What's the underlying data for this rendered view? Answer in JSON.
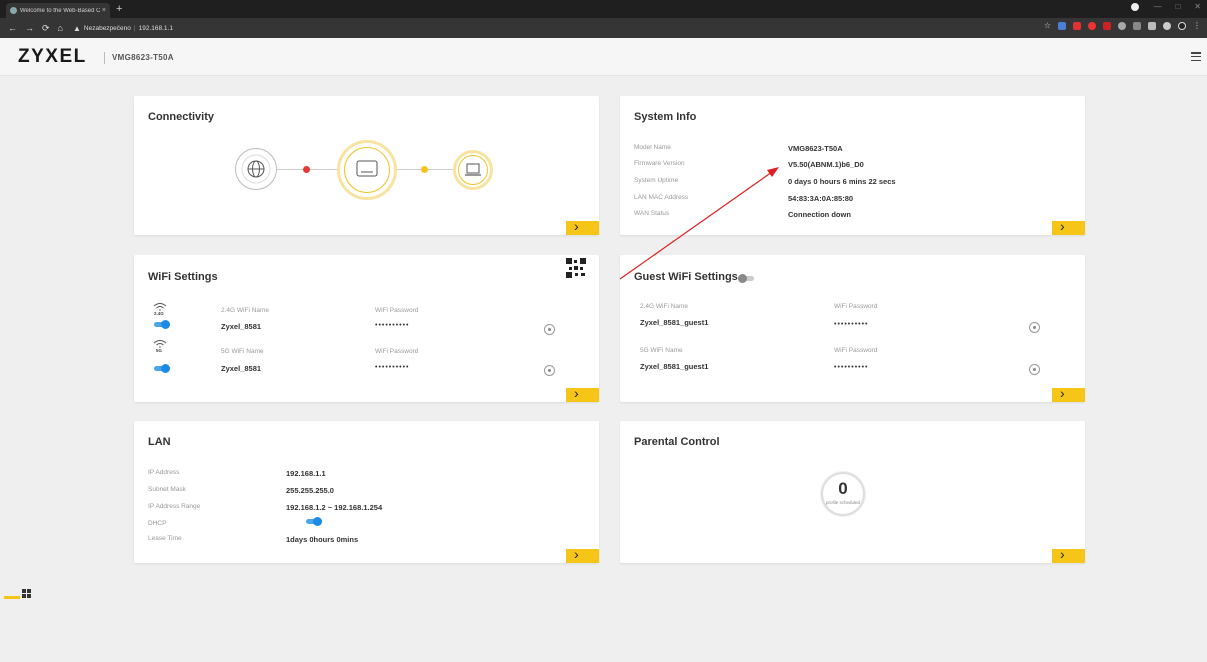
{
  "browser": {
    "tab_title": "Welcome to the Web-Based Co",
    "tab_close": "×",
    "new_tab": "+",
    "security": "Nezabezpečeno",
    "url": "192.168.1.1"
  },
  "header": {
    "logo": "ZYXEL",
    "model": "VMG8623-T50A"
  },
  "connectivity": {
    "title": "Connectivity",
    "status_colors": {
      "internet": "#e53935",
      "lan": "#f5c518"
    }
  },
  "system_info": {
    "title": "System Info",
    "rows": [
      {
        "label": "Model Name",
        "value": "VMG8623-T50A"
      },
      {
        "label": "Firmware Version",
        "value": "V5.50(ABNM.1)b6_D0"
      },
      {
        "label": "System Uptime",
        "value": "0 days 0 hours 6 mins 22 secs"
      },
      {
        "label": "LAN MAC Address",
        "value": "54:83:3A:0A:85:80"
      },
      {
        "label": "WAN Status",
        "value": "Connection down"
      }
    ]
  },
  "wifi": {
    "title": "WiFi Settings",
    "band1": {
      "badge": "2.4G",
      "name_label": "2.4G WiFi Name",
      "name": "Zyxel_8581",
      "pwd_label": "WiFi Password",
      "pwd": "••••••••••"
    },
    "band2": {
      "badge": "5G",
      "name_label": "5G WiFi Name",
      "name": "Zyxel_8581",
      "pwd_label": "WiFi Password",
      "pwd": "••••••••••"
    }
  },
  "guest_wifi": {
    "title": "Guest WiFi Settings",
    "band1": {
      "name_label": "2.4G WiFi Name",
      "name": "Zyxel_8581_guest1",
      "pwd_label": "WiFi Password",
      "pwd": "••••••••••"
    },
    "band2": {
      "name_label": "5G WiFi Name",
      "name": "Zyxel_8581_guest1",
      "pwd_label": "WiFi Password",
      "pwd": "••••••••••"
    }
  },
  "lan": {
    "title": "LAN",
    "rows": [
      {
        "label": "IP Address",
        "value": "192.168.1.1"
      },
      {
        "label": "Subnet Mask",
        "value": "255.255.255.0"
      },
      {
        "label": "IP Address Range",
        "value": "192.168.1.2 ~ 192.168.1.254"
      },
      {
        "label": "DHCP",
        "value": ""
      },
      {
        "label": "Lease Time",
        "value": "1days 0hours 0mins"
      }
    ]
  },
  "parental": {
    "title": "Parental Control",
    "count": "0",
    "caption": "profile scheduled"
  },
  "common": {
    "more": "›",
    "accent": "#f5c518",
    "toggle_on": "#1d8be5"
  }
}
